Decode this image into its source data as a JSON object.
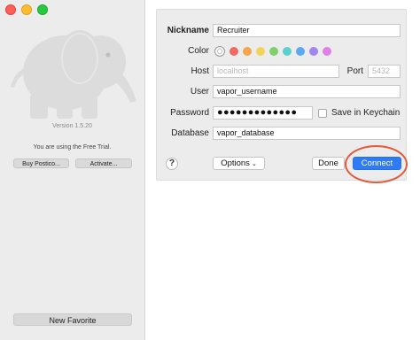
{
  "window": {
    "traffic_lights": [
      "close",
      "minimize",
      "maximize"
    ]
  },
  "sidebar": {
    "logo_icon": "elephant-icon",
    "version": "Version 1.5.20",
    "trial_text": "You are using the Free Trial.",
    "buy_label": "Buy Postico...",
    "activate_label": "Activate...",
    "new_favorite_label": "New Favorite"
  },
  "form": {
    "nickname_label": "Nickname",
    "nickname_value": "Recruiter",
    "color_label": "Color",
    "colors": [
      "none",
      "#f06a63",
      "#f5a54a",
      "#f4d25a",
      "#7fd06b",
      "#5ad0d0",
      "#5aa8f0",
      "#a385f0",
      "#e07fe8"
    ],
    "host_label": "Host",
    "host_placeholder": "localhost",
    "port_label": "Port",
    "port_placeholder": "5432",
    "user_label": "User",
    "user_value": "vapor_username",
    "password_label": "Password",
    "password_value": "●●●●●●●●●●●●●",
    "keychain_label": "Save in Keychain",
    "keychain_checked": false,
    "database_label": "Database",
    "database_value": "vapor_database",
    "help_label": "?",
    "options_label": "Options",
    "done_label": "Done",
    "connect_label": "Connect"
  },
  "annotation": {
    "color": "#e35a3b"
  }
}
